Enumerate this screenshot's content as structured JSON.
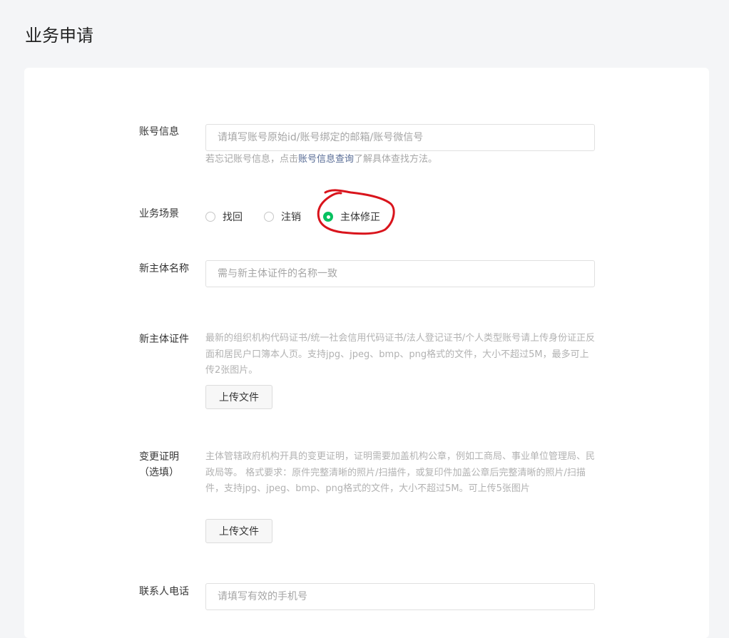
{
  "page_title": "业务申请",
  "account": {
    "label": "账号信息",
    "placeholder": "请填写账号原始id/账号绑定的邮箱/账号微信号",
    "hint_prefix": "若忘记账号信息，点击",
    "hint_link": "账号信息查询",
    "hint_suffix": "了解具体查找方法。"
  },
  "scenario": {
    "label": "业务场景",
    "options": [
      {
        "label": "找回",
        "checked": false
      },
      {
        "label": "注销",
        "checked": false
      },
      {
        "label": "主体修正",
        "checked": true
      }
    ],
    "annotation_color": "#d9141c"
  },
  "new_name": {
    "label": "新主体名称",
    "placeholder": "需与新主体证件的名称一致"
  },
  "new_cert": {
    "label": "新主体证件",
    "description": "最新的组织机构代码证书/统一社会信用代码证书/法人登记证书/个人类型账号请上传身份证正反面和居民户口簿本人页。支持jpg、jpeg、bmp、png格式的文件，大小不超过5M，最多可上传2张图片。",
    "upload_label": "上传文件"
  },
  "change_proof": {
    "label": "变更证明（选填）",
    "description": "主体管辖政府机构开具的变更证明，证明需要加盖机构公章，例如工商局、事业单位管理局、民政局等。 格式要求：原件完整清晰的照片/扫描件，或复印件加盖公章后完整清晰的照片/扫描件，支持jpg、jpeg、bmp、png格式的文件，大小不超过5M。可上传5张图片",
    "upload_label": "上传文件"
  },
  "contact_phone": {
    "label": "联系人电话",
    "placeholder": "请填写有效的手机号"
  },
  "colors": {
    "accent_green": "#07c160",
    "link_blue": "#576b95"
  }
}
